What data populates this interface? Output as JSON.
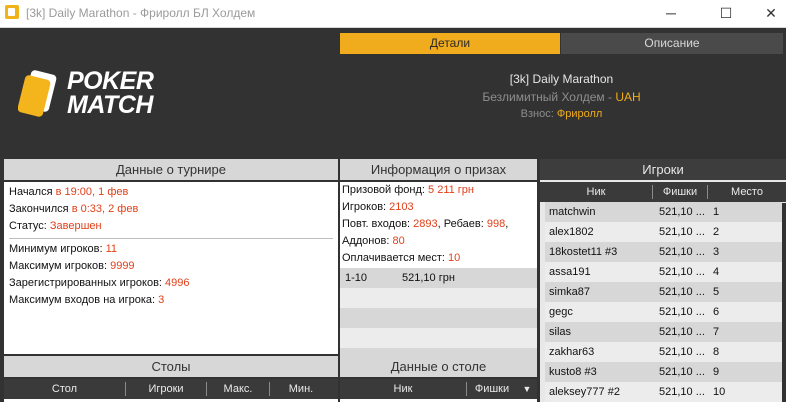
{
  "window": {
    "title": "[3k] Daily Marathon - Фриролл БЛ Холдем",
    "minimize": "─",
    "maximize": "☐",
    "close": "✕"
  },
  "logo": {
    "line1": "POKER",
    "line2": "MATCH"
  },
  "tabs": {
    "details": "Детали",
    "description": "Описание"
  },
  "tournament": {
    "name": "[3k] Daily Marathon",
    "game_prefix": "Безлимитный Холдем - ",
    "currency": "UAH",
    "buyin_label": "Взнос: ",
    "buyin_value": "Фриролл"
  },
  "tourney_data": {
    "title": "Данные о турнире",
    "started_label": "Начался ",
    "started_value": "в 19:00, 1 фев",
    "finished_label": "Закончился ",
    "finished_value": "в 0:33, 2 фев",
    "status_label": "Статус: ",
    "status_value": "Завершен",
    "min_players_label": "Минимум игроков: ",
    "min_players_value": "11",
    "max_players_label": "Максимум игроков: ",
    "max_players_value": "9999",
    "registered_label": "Зарегистрированных игроков: ",
    "registered_value": "4996",
    "max_entries_label": "Максимум входов на игрока: ",
    "max_entries_value": "3"
  },
  "prize_info": {
    "title": "Информация о призах",
    "pool_label": "Призовой фонд: ",
    "pool_value": "5 211 грн",
    "players_label": "Игроков: ",
    "players_value": "2103",
    "reentries_label": "Повт. входов: ",
    "reentries_value": "2893",
    "rebuys_label": ", Ребаев: ",
    "rebuys_value": "998",
    "addons_label": "Аддонов: ",
    "addons_value": "80",
    "paid_label": "Оплачивается мест: ",
    "paid_value": "10",
    "payouts": [
      {
        "places": "1-10",
        "amount": "521,10 грн"
      }
    ]
  },
  "players": {
    "title": "Игроки",
    "col_nick": "Ник",
    "col_chips": "Фишки",
    "col_place": "Место",
    "rows": [
      {
        "nick": "matchwin",
        "chips": "521,10 ...",
        "place": "1"
      },
      {
        "nick": "alex1802",
        "chips": "521,10 ...",
        "place": "2"
      },
      {
        "nick": "18kostet11 #3",
        "chips": "521,10 ...",
        "place": "3"
      },
      {
        "nick": "assa191",
        "chips": "521,10 ...",
        "place": "4"
      },
      {
        "nick": "simka87",
        "chips": "521,10 ...",
        "place": "5"
      },
      {
        "nick": "gegc",
        "chips": "521,10 ...",
        "place": "6"
      },
      {
        "nick": "silas",
        "chips": "521,10 ...",
        "place": "7"
      },
      {
        "nick": "zakhar63",
        "chips": "521,10 ...",
        "place": "8"
      },
      {
        "nick": "kusto8 #3",
        "chips": "521,10 ...",
        "place": "9"
      },
      {
        "nick": "aleksey777 #2",
        "chips": "521,10 ...",
        "place": "10"
      }
    ]
  },
  "tables": {
    "title": "Столы",
    "col_table": "Стол",
    "col_players": "Игроки",
    "col_max": "Макс.",
    "col_min": "Мин."
  },
  "table_data": {
    "title": "Данные о столе",
    "col_nick": "Ник",
    "col_chips": "Фишки"
  },
  "colors": {
    "accent": "#f0ac1c",
    "value_red": "#e0401a",
    "header_bg": "#323232"
  }
}
